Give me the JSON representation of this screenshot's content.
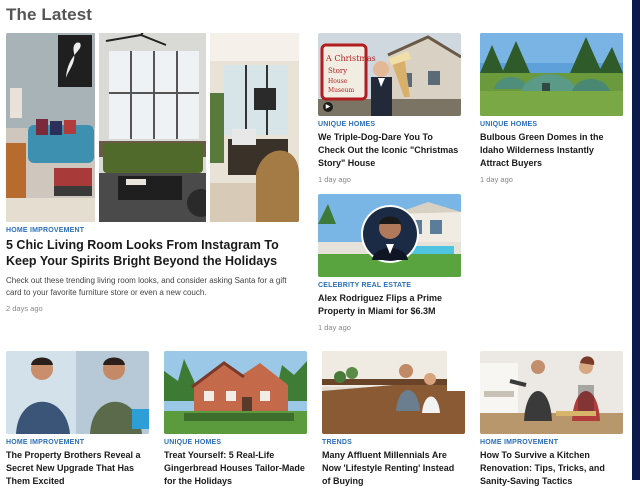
{
  "page": {
    "title": "The Latest"
  },
  "featured": {
    "category": "HOME IMPROVEMENT",
    "headline": "5 Chic Living Room Looks From Instagram To Keep Your Spirits Bright Beyond the Holidays",
    "description": "Check out these trending living room looks, and consider asking Santa for a gift card to your favorite furniture store or even a new couch.",
    "time": "2 days ago"
  },
  "cards": [
    {
      "category": "UNIQUE HOMES",
      "headline": "We Triple-Dog-Dare You To Check Out the Iconic \"Christmas Story\" House",
      "time": "1 day ago",
      "image_text": "A Christmas Story House Museum"
    },
    {
      "category": "UNIQUE HOMES",
      "headline": "Bulbous Green Domes in the Idaho Wilderness Instantly Attract Buyers",
      "time": "1 day ago"
    },
    {
      "category": "CELEBRITY REAL ESTATE",
      "headline": "Alex Rodriguez Flips a Prime Property in Miami for $6.3M",
      "time": "1 day ago"
    }
  ],
  "bottom": [
    {
      "category": "HOME IMPROVEMENT",
      "headline": "The Property Brothers Reveal a Secret New Upgrade That Has Them Excited"
    },
    {
      "category": "UNIQUE HOMES",
      "headline": "Treat Yourself: 5 Real-Life Gingerbread Houses Tailor-Made for the Holidays"
    },
    {
      "category": "TRENDS",
      "headline": "Many Affluent Millennials Are Now 'Lifestyle Renting' Instead of Buying"
    },
    {
      "category": "HOME IMPROVEMENT",
      "headline": "How To Survive a Kitchen Renovation: Tips, Tricks, and Sanity-Saving Tactics"
    }
  ]
}
